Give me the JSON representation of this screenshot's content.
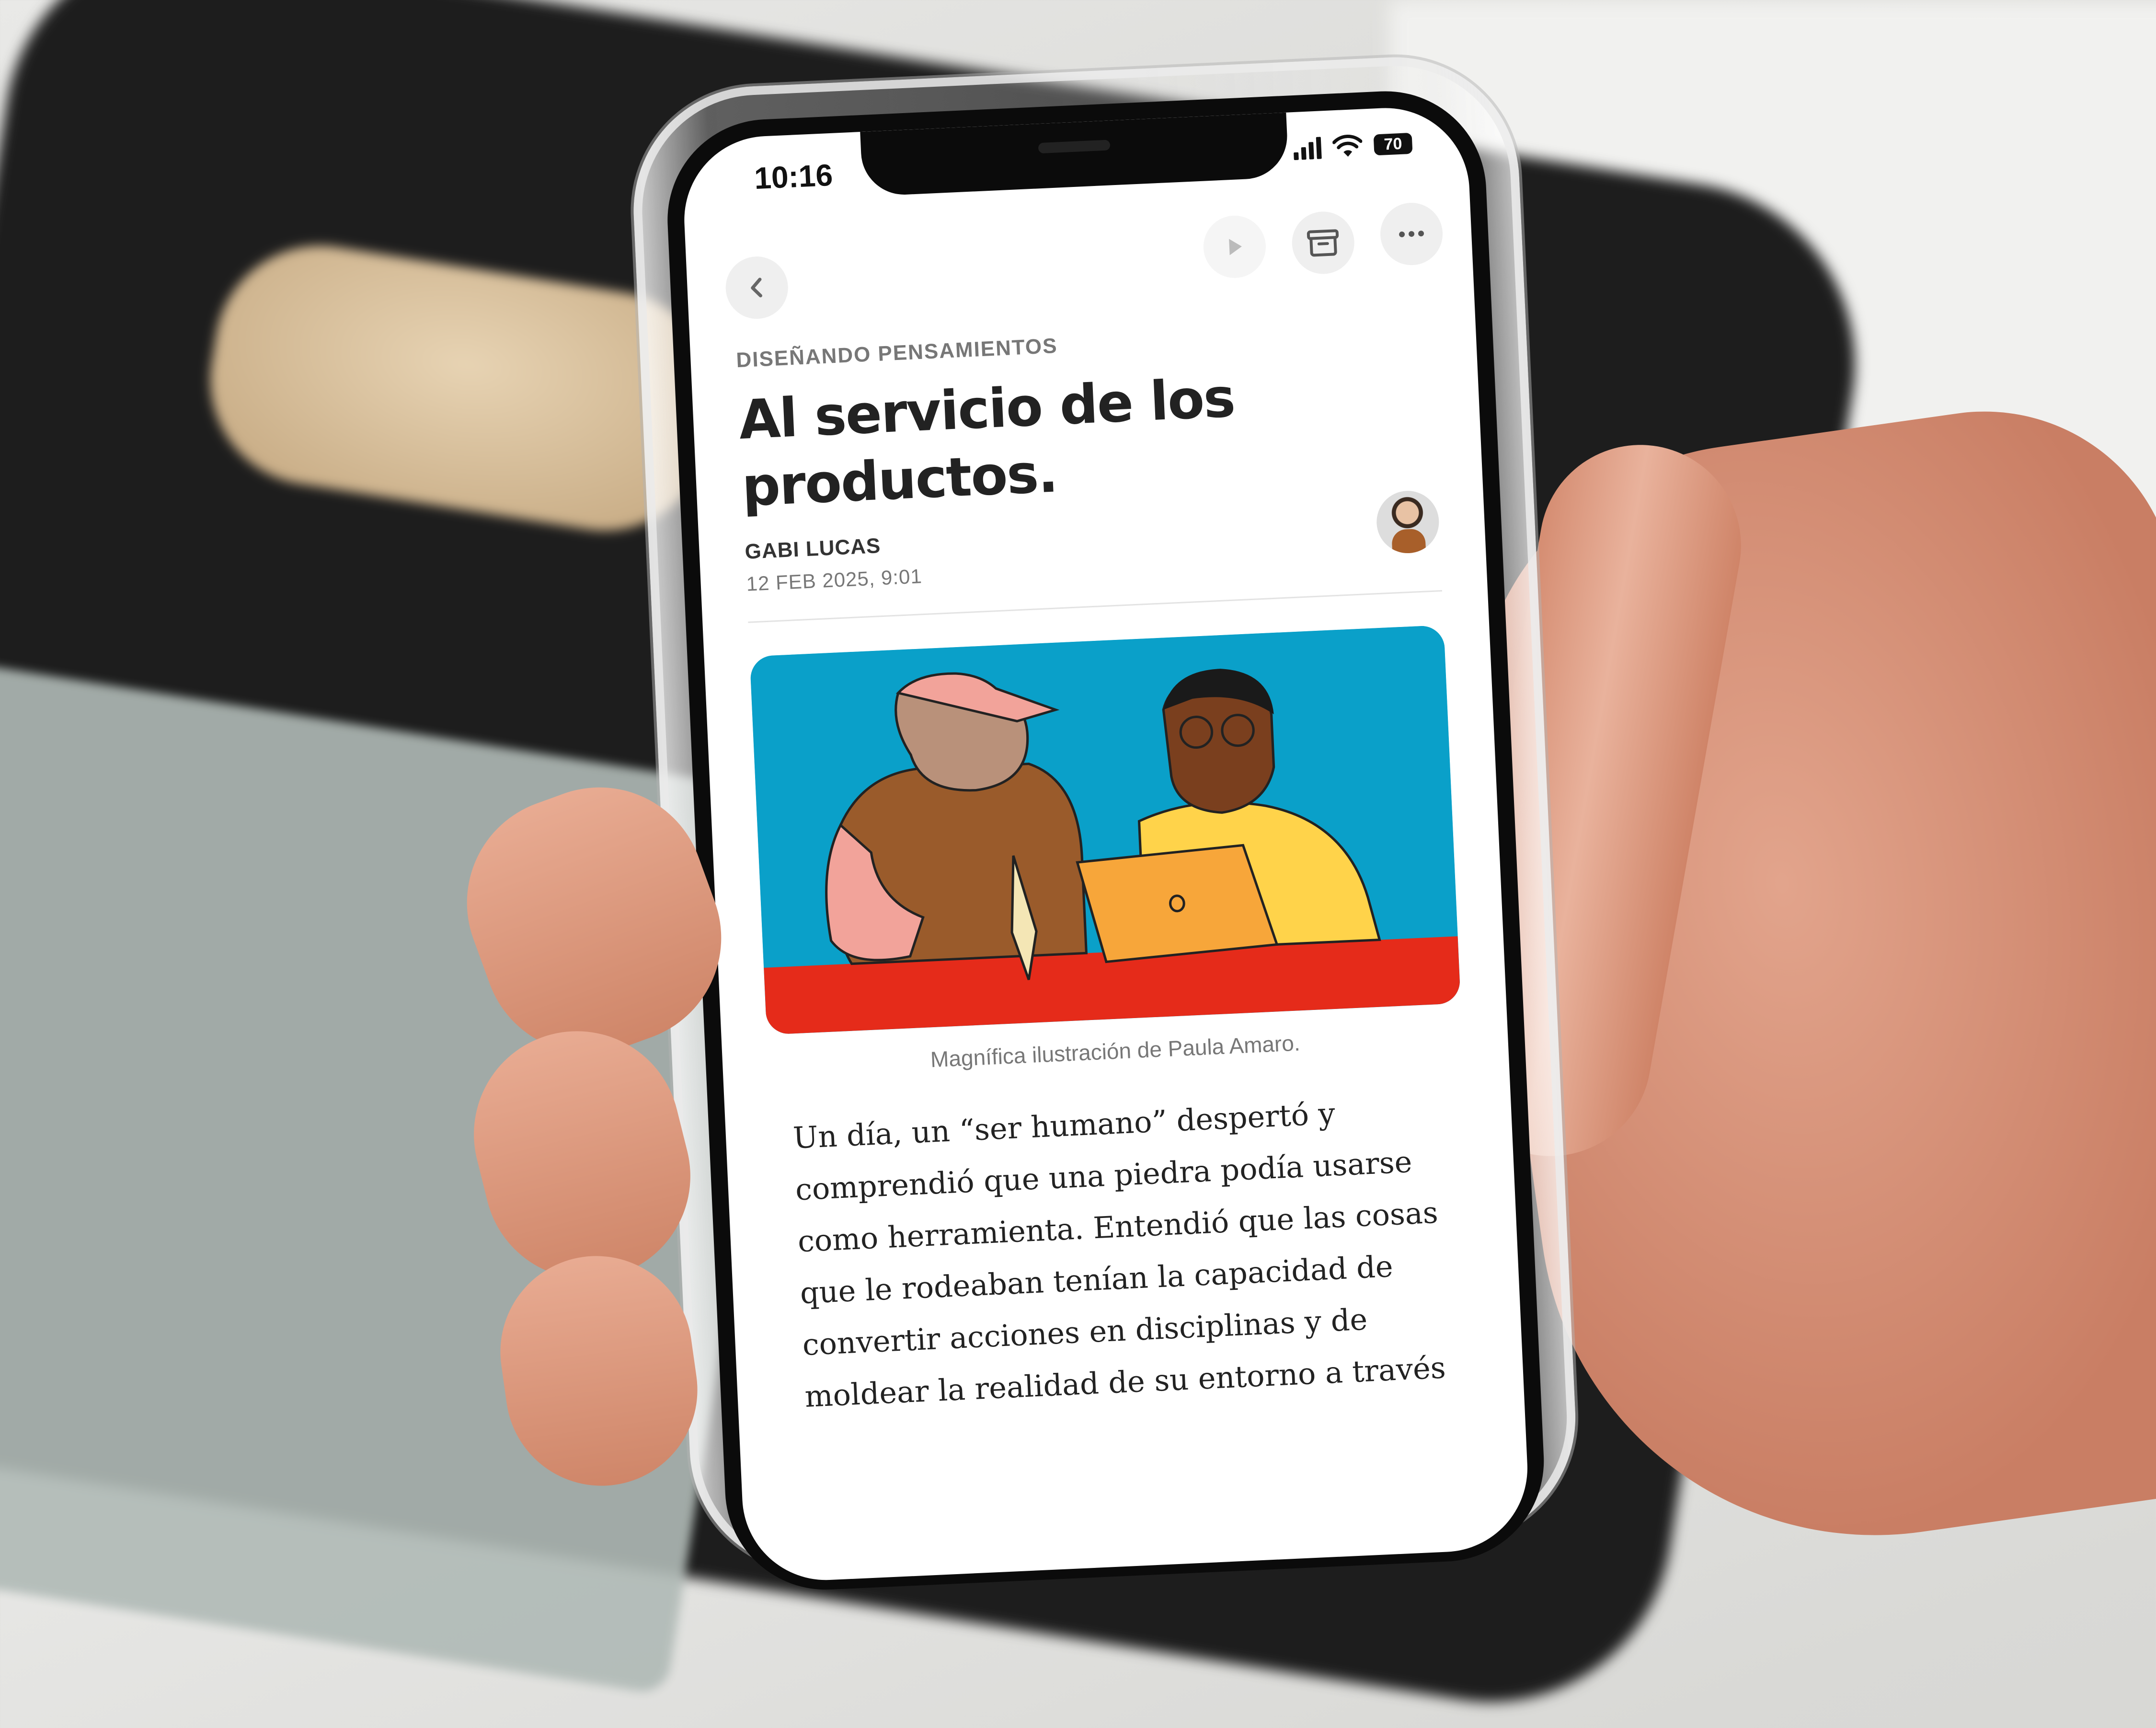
{
  "status_bar": {
    "time": "10:16",
    "battery": "70"
  },
  "toolbar": {
    "back_icon": "chevron-left-icon",
    "play_icon": "play-icon",
    "archive_icon": "archive-box-icon",
    "more_icon": "ellipsis-icon"
  },
  "article": {
    "section": "DISEÑANDO PENSAMIENTOS",
    "title": "Al servicio de los productos.",
    "author": "GABI LUCAS",
    "date": "12 FEB 2025, 9:01",
    "image_caption": "Magnífica ilustración de Paula Amaro.",
    "body": "Un día, un “ser humano” despertó y comprendió que una piedra podía usarse como herramienta. Entendió que las cosas que le rodeaban tenían la capacidad de convertir acciones en disciplinas y de moldear la realidad de su entorno a través"
  },
  "colors": {
    "illustration_bg": "#0aa0c9",
    "table_red": "#e52b1a",
    "shirt_yellow": "#ffd34a",
    "laptop_orange": "#f7a63a",
    "skin_pink": "#f2a39a",
    "vest_brown": "#9a5b2b"
  }
}
